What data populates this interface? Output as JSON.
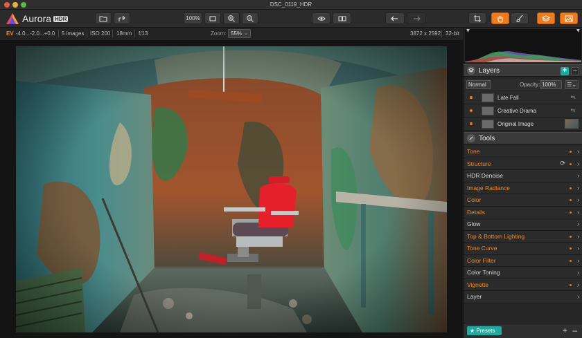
{
  "window": {
    "title": "DSC_0119_HDR"
  },
  "app": {
    "name": "Aurora",
    "badge": "HDR"
  },
  "toolbar": {
    "zoom_100_label": "100%",
    "icons": [
      "open-folder-icon",
      "share-icon",
      "fit-screen-icon",
      "zoom-in-icon",
      "zoom-out-icon",
      "eye-preview-icon",
      "compare-icon",
      "undo-icon",
      "redo-icon",
      "crop-icon",
      "hand-icon",
      "brush-icon",
      "layers-icon",
      "histogram-icon"
    ]
  },
  "infobar": {
    "ev_label": "EV",
    "ev_values": "-4.0...-2.0...+0.0",
    "images": "5 images",
    "iso": "ISO 200",
    "focal": "18mm",
    "aperture": "f/13",
    "zoom_label": "Zoom:",
    "zoom_value": "55%",
    "dimensions": "3872 x 2592",
    "bit_depth": "32-bit"
  },
  "layers": {
    "title": "Layers",
    "blend_mode": "Normal",
    "opacity_label": "Opacity:",
    "opacity_value": "100%",
    "items": [
      {
        "name": "Late Fall"
      },
      {
        "name": "Creative Drama"
      },
      {
        "name": "Original Image"
      }
    ]
  },
  "tools": {
    "title": "Tools",
    "items": [
      {
        "name": "Tone",
        "active": true
      },
      {
        "name": "Structure",
        "active": true
      },
      {
        "name": "HDR Denoise",
        "active": false
      },
      {
        "name": "Image Radiance",
        "active": true
      },
      {
        "name": "Color",
        "active": true
      },
      {
        "name": "Details",
        "active": true
      },
      {
        "name": "Glow",
        "active": false
      },
      {
        "name": "Top & Bottom Lighting",
        "active": true
      },
      {
        "name": "Tone Curve",
        "active": true
      },
      {
        "name": "Color Filter",
        "active": true
      },
      {
        "name": "Color Toning",
        "active": false
      },
      {
        "name": "Vignette",
        "active": true
      },
      {
        "name": "Layer",
        "active": false
      }
    ]
  },
  "footer": {
    "presets_label": "★ Presets"
  },
  "colors": {
    "accent_orange": "#f07b1c",
    "accent_teal": "#1fa9a0",
    "panel_bg": "#262626"
  }
}
